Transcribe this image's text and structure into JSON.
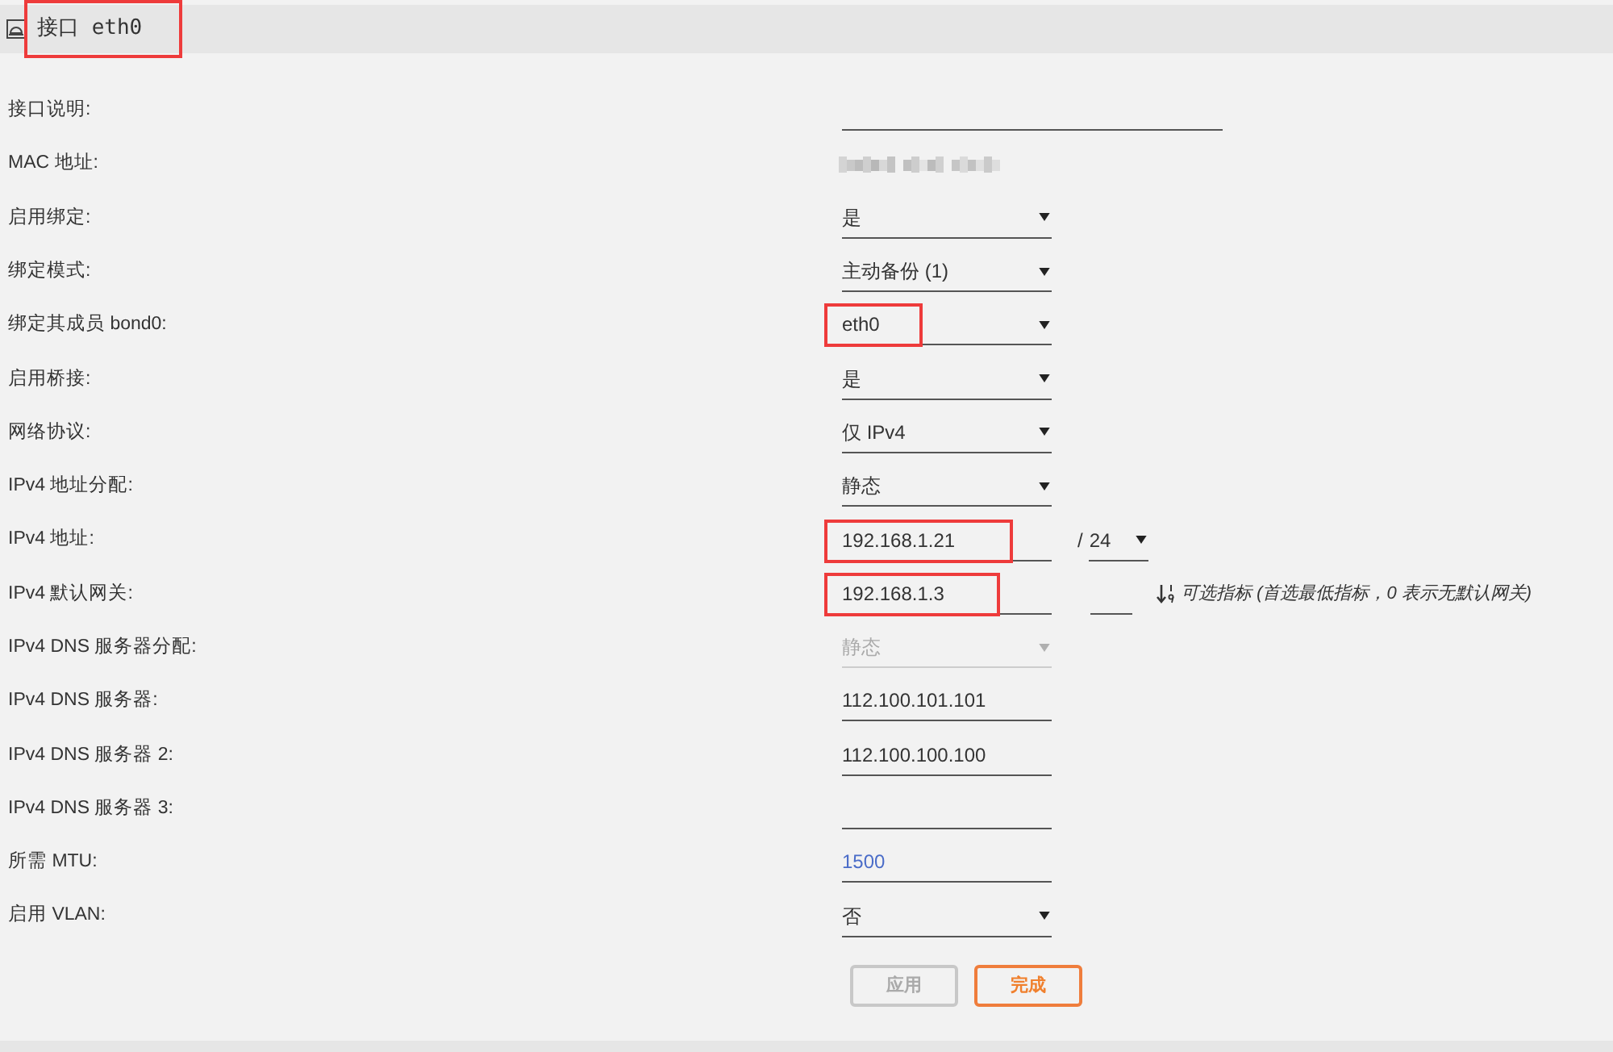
{
  "header": {
    "title": "接口 eth0",
    "highlighted": true
  },
  "fields": [
    {
      "label": "接口说明:",
      "kind": "text",
      "disabled": false,
      "highlighted": false
    },
    {
      "label": "MAC 地址:",
      "kind": "redacted"
    },
    {
      "label": "启用绑定:",
      "kind": "select",
      "value": "是",
      "disabled": false,
      "highlighted": false
    },
    {
      "label": "绑定模式:",
      "kind": "select",
      "value": "主动备份 (1)",
      "disabled": false,
      "highlighted": false
    },
    {
      "label": "绑定其成员 bond0:",
      "kind": "select",
      "value": "eth0",
      "disabled": false,
      "highlighted": true
    },
    {
      "label": "启用桥接:",
      "kind": "select",
      "value": "是",
      "disabled": false,
      "highlighted": false
    },
    {
      "label": "网络协议:",
      "kind": "select",
      "value": "仅 IPv4",
      "disabled": false,
      "highlighted": false
    },
    {
      "label": "IPv4 地址分配:",
      "kind": "select",
      "value": "静态",
      "disabled": false,
      "highlighted": false
    },
    {
      "label": "IPv4 地址:",
      "kind": "text",
      "value": "192.168.1.21",
      "disabled": false,
      "highlighted": true,
      "extra": {
        "kind": "prefix",
        "separator": "/",
        "value": "24"
      }
    },
    {
      "label": "IPv4 默认网关:",
      "kind": "text",
      "value": "192.168.1.3",
      "disabled": false,
      "highlighted": true,
      "extra": {
        "kind": "metric",
        "hint": "可选指标 (首选最低指标，0 表示无默认网关)"
      }
    },
    {
      "label": "IPv4 DNS 服务器分配:",
      "kind": "select",
      "value": "静态",
      "disabled": true,
      "highlighted": false
    },
    {
      "label": "IPv4 DNS 服务器:",
      "kind": "text",
      "value": "112.100.101.101",
      "disabled": false,
      "highlighted": false
    },
    {
      "label": "IPv4 DNS 服务器 2:",
      "kind": "text",
      "value": "112.100.100.100",
      "disabled": false,
      "highlighted": false
    },
    {
      "label": "IPv4 DNS 服务器 3:",
      "kind": "text",
      "disabled": false,
      "highlighted": false
    },
    {
      "label": "所需 MTU:",
      "kind": "text",
      "placeholder": "1500",
      "disabled": false,
      "highlighted": false
    },
    {
      "label": "启用 VLAN:",
      "kind": "select",
      "value": "否",
      "disabled": false,
      "highlighted": false
    }
  ],
  "buttons": [
    {
      "label": "应用",
      "disabled": true
    },
    {
      "label": "完成",
      "disabled": false
    }
  ]
}
